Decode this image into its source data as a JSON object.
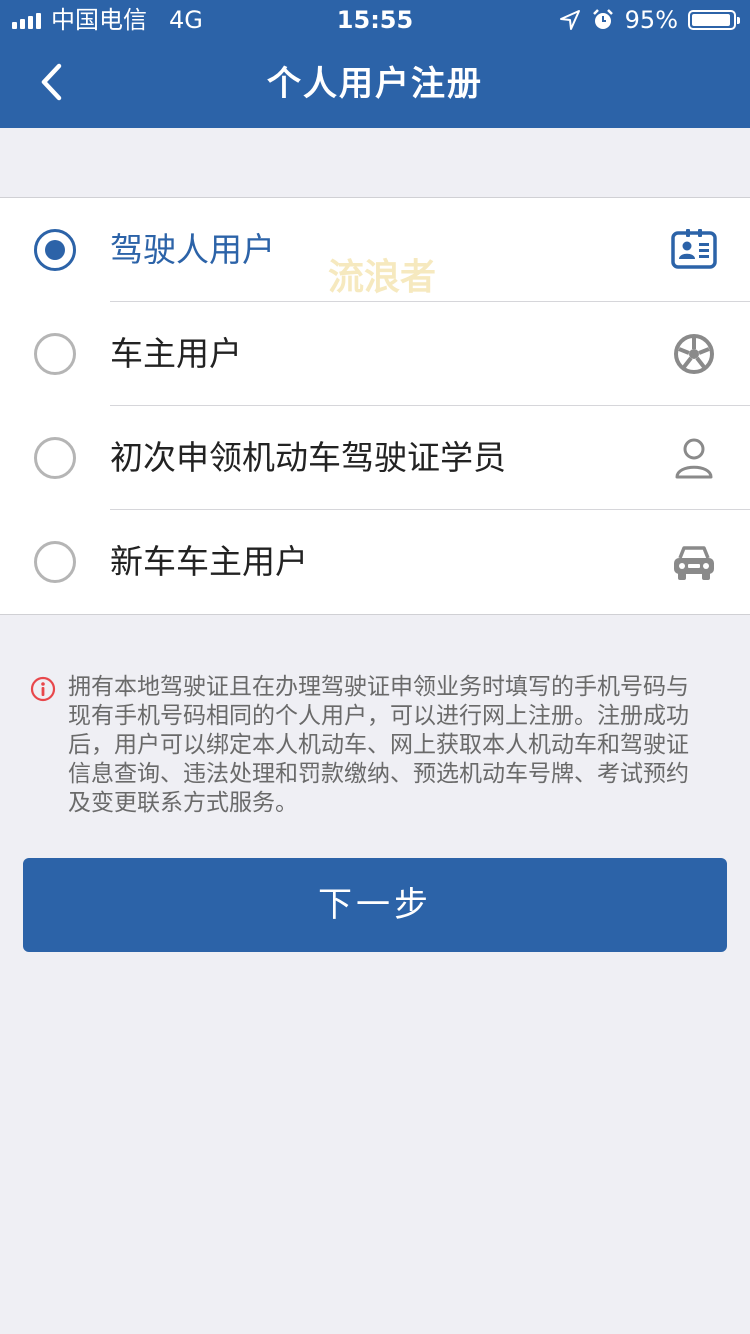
{
  "status_bar": {
    "carrier": "中国电信",
    "network": "4G",
    "time": "15:55",
    "battery_percent": "95%",
    "battery_level": 0.95
  },
  "header": {
    "title": "个人用户注册",
    "back_icon": "chevron-left-icon"
  },
  "user_types": [
    {
      "label": "驾驶人用户",
      "selected": true,
      "icon": "id-card-icon"
    },
    {
      "label": "车主用户",
      "selected": false,
      "icon": "wheel-icon"
    },
    {
      "label": "初次申领机动车驾驶证学员",
      "selected": false,
      "icon": "person-icon"
    },
    {
      "label": "新车车主用户",
      "selected": false,
      "icon": "car-icon"
    }
  ],
  "watermark": "流浪者",
  "notice": {
    "icon": "info-icon",
    "text": "拥有本地驾驶证且在办理驾驶证申领业务时填写的手机号码与现有手机号码相同的个人用户，可以进行网上注册。注册成功后，用户可以绑定本人机动车、网上获取本人机动车和驾驶证信息查询、违法处理和罚款缴纳、预选机动车号牌、考试预约及变更联系方式服务。"
  },
  "next_button": {
    "label": "下一步"
  },
  "colors": {
    "primary": "#2c63a8",
    "background": "#efeff4",
    "notice_icon": "#e8474b"
  }
}
